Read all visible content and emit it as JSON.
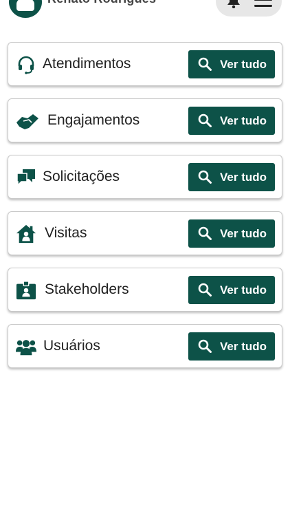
{
  "header": {
    "user_name": "Renato Rodrigues"
  },
  "colors": {
    "brand": "#0d5248",
    "card_border": "#c9c9c9"
  },
  "sections": [
    {
      "label": "Atendimentos",
      "icon": "headset-icon",
      "button": "Ver tudo"
    },
    {
      "label": "Engajamentos",
      "icon": "handshake-icon",
      "button": "Ver tudo"
    },
    {
      "label": "Solicitações",
      "icon": "chat-bubbles-icon",
      "button": "Ver tudo"
    },
    {
      "label": "Visitas",
      "icon": "house-person-icon",
      "button": "Ver tudo"
    },
    {
      "label": "Stakeholders",
      "icon": "id-badge-icon",
      "button": "Ver tudo"
    },
    {
      "label": "Usuários",
      "icon": "users-icon",
      "button": "Ver tudo"
    }
  ]
}
